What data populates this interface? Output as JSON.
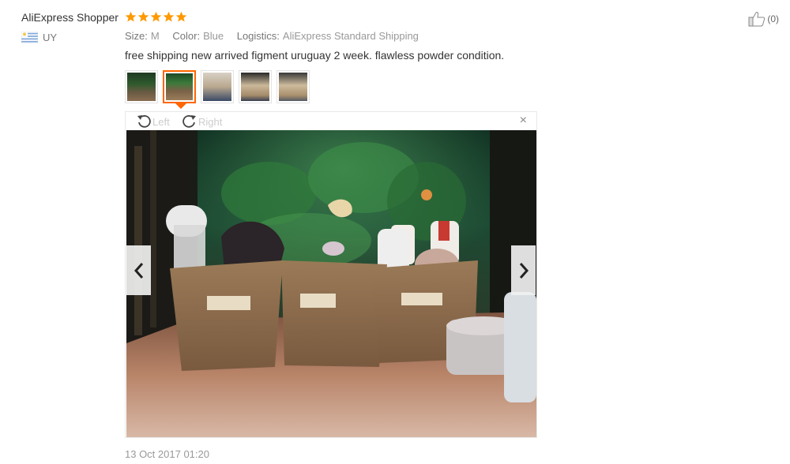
{
  "review": {
    "reviewer_name": "AliExpress Shopper",
    "rating": 5,
    "country_code": "UY",
    "helpful_count": "(0)",
    "attributes": {
      "size_label": "Size:",
      "size_value": "M",
      "color_label": "Color:",
      "color_value": "Blue",
      "logistics_label": "Logistics:",
      "logistics_value": "AliExpress Standard Shipping"
    },
    "comment": "free shipping new arrived figment uruguay 2 week. flawless powder condition.",
    "thumbnail_count": 5,
    "active_thumbnail": 2,
    "viewer": {
      "rotate_left_label": "Left",
      "rotate_right_label": "Right",
      "close_glyph": "×"
    },
    "date": "13 Oct 2017 01:20"
  },
  "colors": {
    "star": "#ff9900",
    "active_thumb_border": "#ff6600",
    "muted_text": "#999999"
  },
  "icons": [
    "star-icon",
    "uruguay-flag-icon",
    "thumbs-up-icon",
    "rotate-left-icon",
    "rotate-right-icon",
    "close-icon",
    "chevron-left-icon",
    "chevron-right-icon"
  ]
}
